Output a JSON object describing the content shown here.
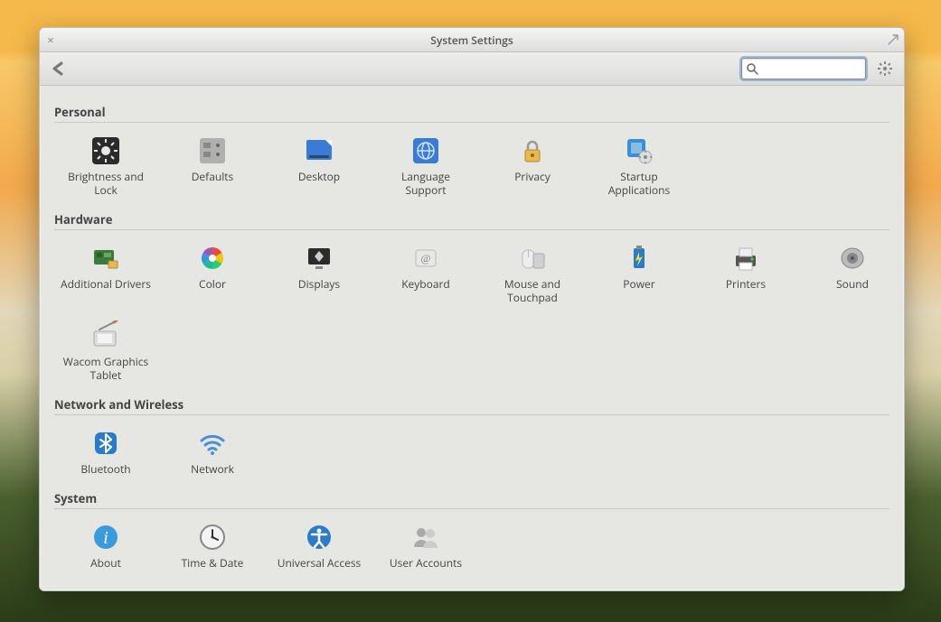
{
  "window": {
    "title": "System Settings"
  },
  "toolbar": {
    "search_placeholder": ""
  },
  "sections": {
    "personal": {
      "title": "Personal",
      "items": [
        {
          "id": "brightness-and-lock",
          "label": "Brightness and Lock"
        },
        {
          "id": "defaults",
          "label": "Defaults"
        },
        {
          "id": "desktop",
          "label": "Desktop"
        },
        {
          "id": "language-support",
          "label": "Language Support"
        },
        {
          "id": "privacy",
          "label": "Privacy"
        },
        {
          "id": "startup-applications",
          "label": "Startup Applications"
        }
      ]
    },
    "hardware": {
      "title": "Hardware",
      "items": [
        {
          "id": "additional-drivers",
          "label": "Additional Drivers"
        },
        {
          "id": "color",
          "label": "Color"
        },
        {
          "id": "displays",
          "label": "Displays"
        },
        {
          "id": "keyboard",
          "label": "Keyboard"
        },
        {
          "id": "mouse-and-touchpad",
          "label": "Mouse and Touchpad"
        },
        {
          "id": "power",
          "label": "Power"
        },
        {
          "id": "printers",
          "label": "Printers"
        },
        {
          "id": "sound",
          "label": "Sound"
        },
        {
          "id": "wacom-graphics-tablet",
          "label": "Wacom Graphics Tablet"
        }
      ]
    },
    "network": {
      "title": "Network and Wireless",
      "items": [
        {
          "id": "bluetooth",
          "label": "Bluetooth"
        },
        {
          "id": "network",
          "label": "Network"
        }
      ]
    },
    "system": {
      "title": "System",
      "items": [
        {
          "id": "about",
          "label": "About"
        },
        {
          "id": "time-and-date",
          "label": "Time & Date"
        },
        {
          "id": "universal-access",
          "label": "Universal Access"
        },
        {
          "id": "user-accounts",
          "label": "User Accounts"
        }
      ]
    }
  }
}
